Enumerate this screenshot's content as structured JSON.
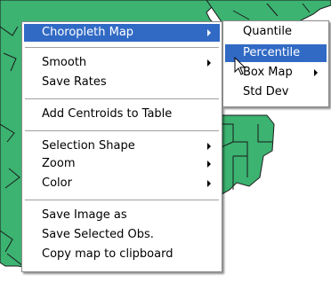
{
  "colors": {
    "map_fill": "#3cb371",
    "map_line": "#1a1a1a",
    "highlight": "#316ac5",
    "menu_bg": "#ffffff"
  },
  "context_menu": {
    "items": [
      {
        "label": "Choropleth Map",
        "submenu": true,
        "highlighted": true
      },
      {
        "label": "Smooth",
        "submenu": true
      },
      {
        "label": "Save Rates",
        "submenu": false
      },
      {
        "label": "Add Centroids to Table",
        "submenu": false
      },
      {
        "label": "Selection Shape",
        "submenu": true
      },
      {
        "label": "Zoom",
        "submenu": true
      },
      {
        "label": "Color",
        "submenu": true
      },
      {
        "label": "Save Image as",
        "submenu": false
      },
      {
        "label": "Save Selected Obs.",
        "submenu": false
      },
      {
        "label": "Copy  map to clipboard",
        "submenu": false
      }
    ]
  },
  "choropleth_submenu": {
    "items": [
      {
        "label": "Quantile",
        "submenu": false
      },
      {
        "label": "Percentile",
        "submenu": false,
        "highlighted": true
      },
      {
        "label": "Box Map",
        "submenu": true
      },
      {
        "label": "Std Dev",
        "submenu": false
      }
    ]
  },
  "cursor": {
    "icon": "arrow-cursor-icon"
  }
}
